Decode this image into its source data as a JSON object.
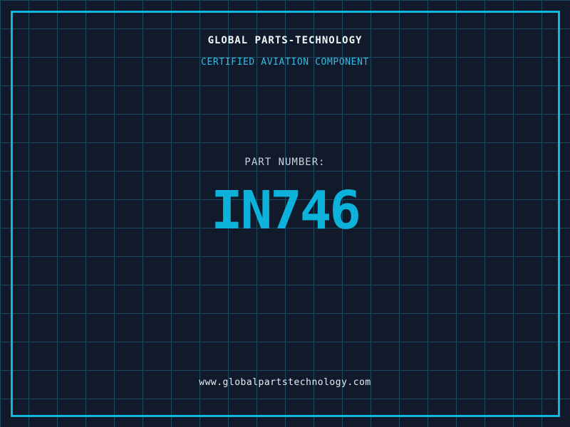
{
  "header": {
    "company": "GLOBAL PARTS-TECHNOLOGY",
    "subtitle": "CERTIFIED AVIATION COMPONENT"
  },
  "part": {
    "label": "PART NUMBER:",
    "number": "IN746"
  },
  "footer": {
    "website": "www.globalpartstechnology.com"
  },
  "colors": {
    "bg": "#101a2b",
    "grid": "#1b4a60",
    "frame": "#12b7e0",
    "accent": "#0cb2da",
    "subtitle": "#35b9e0",
    "white": "#f2f6f8",
    "label-gray": "#c9d3dd",
    "url-white": "#e6edf3"
  }
}
